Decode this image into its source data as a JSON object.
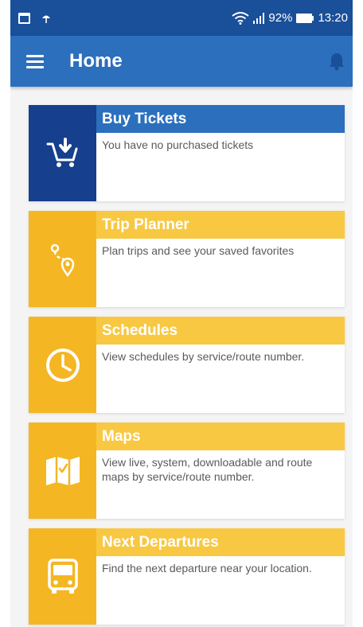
{
  "status_bar": {
    "battery": "92%",
    "time": "13:20"
  },
  "app_bar": {
    "title": "Home"
  },
  "cards": [
    {
      "title": "Buy Tickets",
      "description": "You have no purchased tickets",
      "icon": "cart-icon"
    },
    {
      "title": "Trip Planner",
      "description": "Plan trips and see your saved favorites",
      "icon": "route-icon"
    },
    {
      "title": "Schedules",
      "description": "View schedules by service/route number.",
      "icon": "clock-icon"
    },
    {
      "title": "Maps",
      "description": "View live, system, downloadable and route maps by service/route number.",
      "icon": "map-icon"
    },
    {
      "title": "Next Departures",
      "description": "Find the next departure near your location.",
      "icon": "bus-icon"
    }
  ],
  "colors": {
    "status_bar": "#1a4f99",
    "app_bar": "#2c6fbd",
    "blue_icon_bg": "#163f8d",
    "yellow_icon_bg": "#f4b623",
    "yellow_title_bg": "#f8c843"
  }
}
